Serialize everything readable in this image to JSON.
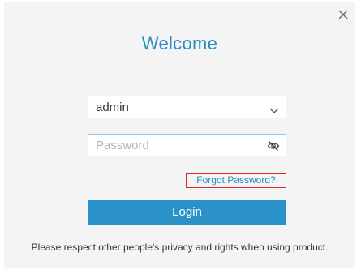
{
  "dialog": {
    "title": "Welcome",
    "close_icon": "close-icon",
    "username": {
      "value": "admin",
      "dropdown_icon": "chevron-down-icon"
    },
    "password": {
      "placeholder": "Password",
      "visibility_icon": "eye-slash-icon"
    },
    "forgot_password_label": "Forgot Password?",
    "login_label": "Login",
    "notice": "Please respect other people's privacy and rights when using product."
  },
  "colors": {
    "accent": "#2a92c8",
    "title_text": "#2a8cc4",
    "highlight_border": "#e0242d",
    "dialog_background": "#f4f4f4"
  }
}
